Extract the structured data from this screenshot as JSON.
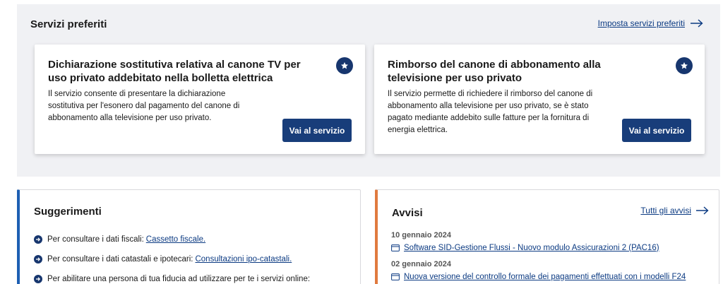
{
  "favorites": {
    "title": "Servizi preferiti",
    "set_link": "Imposta servizi preferiti",
    "cards": [
      {
        "title": "Dichiarazione sostitutiva relativa al canone TV per uso privato addebitato nella bolletta elettrica",
        "description": "Il servizio consente di presentare la dichiarazione sostitutiva per l'esonero dal pagamento del canone di abbonamento alla televisione per uso privato.",
        "button": "Vai al servizio"
      },
      {
        "title": "Rimborso del canone di abbonamento alla televisione per uso privato",
        "description": "Il servizio permette di richiedere il rimborso del canone di abbonamento alla televisione per uso privato, se è stato pagato mediante addebito sulle fatture per la fornitura di energia elettrica.",
        "button": "Vai al servizio"
      }
    ]
  },
  "suggestions": {
    "title": "Suggerimenti",
    "items": [
      {
        "text": "Per consultare i dati fiscali:",
        "link": "Cassetto fiscale."
      },
      {
        "text": "Per consultare i dati catastali e ipotecari:",
        "link": "Consultazioni ipo-catastali."
      },
      {
        "text": "Per abilitare una persona di tua fiducia ad utilizzare per te i servizi online:",
        "link": ""
      }
    ]
  },
  "notices": {
    "title": "Avvisi",
    "all_link": "Tutti gli avvisi",
    "items": [
      {
        "date": "10 gennaio 2024",
        "text": "Software SID-Gestione Flussi - Nuovo modulo Assicurazioni 2 (PAC16)"
      },
      {
        "date": "02 gennaio 2024",
        "text": "Nuova versione del controllo formale dei pagamenti effettuati con i modelli F24"
      }
    ]
  },
  "colors": {
    "accent_blue": "#17366e",
    "button_blue": "#183d7a",
    "link_blue": "#0b3a82",
    "suggestions_border": "#1e5fb3",
    "notices_border": "#e07a3f",
    "panel_bg": "#f0f1f4"
  }
}
